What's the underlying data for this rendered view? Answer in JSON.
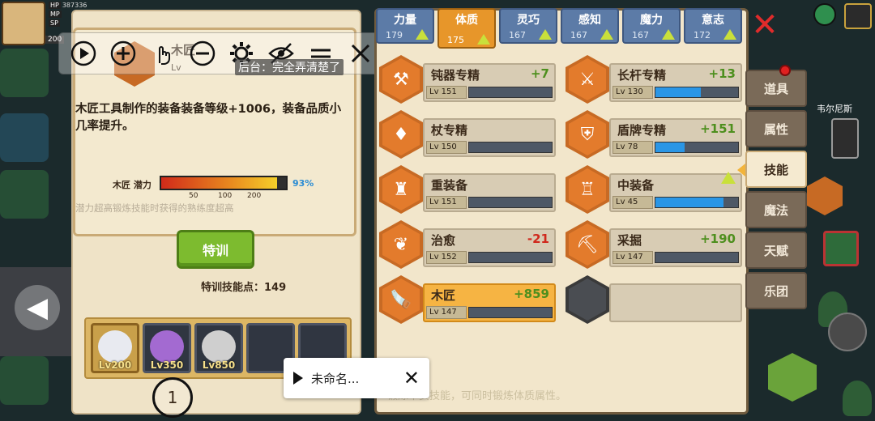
{
  "hud": {
    "hp_label": "HP",
    "hp_value": "387336",
    "mp_label": "MP",
    "sp_label": "SP",
    "level": "200"
  },
  "selected_skill": {
    "name": "木匠",
    "level": "Lv",
    "description": "木匠工具制作的装备装备等级+1006，装备品质小几率提升。",
    "potential_label": "木匠 潜力",
    "potential_percent": "93%",
    "potential_value": 0.93,
    "ticks": [
      "50",
      "100",
      "200"
    ],
    "note": "潜力超高锻炼技能时获得的熟练度超高"
  },
  "toolbar": {
    "caption": "后台：完全弄清楚了"
  },
  "training": {
    "button_label": "特训",
    "points_label": "特训技能点：",
    "points_value": "149"
  },
  "party": [
    {
      "level": "Lv200",
      "color": "#e8eaf0",
      "selected": true
    },
    {
      "level": "Lv350",
      "color": "#a36ad1",
      "selected": false
    },
    {
      "level": "Lv850",
      "color": "#cfcfcf",
      "selected": false
    },
    {
      "level": "",
      "color": "",
      "selected": false
    },
    {
      "level": "",
      "color": "",
      "selected": false
    }
  ],
  "crosshair_label": "1",
  "stat_tabs": [
    {
      "name": "力量",
      "value": "179",
      "active": false
    },
    {
      "name": "体质",
      "value": "175",
      "active": true
    },
    {
      "name": "灵巧",
      "value": "167",
      "active": false
    },
    {
      "name": "感知",
      "value": "167",
      "active": false
    },
    {
      "name": "魔力",
      "value": "167",
      "active": false
    },
    {
      "name": "意志",
      "value": "172",
      "active": false
    }
  ],
  "skills": [
    {
      "name": "钝器专精",
      "bonus": "+7",
      "bonus_color": "#4e8f1e",
      "lv": "Lv 151",
      "progress": 0,
      "icon": "hammer-icon",
      "glyph": "⚒"
    },
    {
      "name": "长杆专精",
      "bonus": "+13",
      "bonus_color": "#4e8f1e",
      "lv": "Lv 130",
      "progress": 0.55,
      "icon": "spear-icon",
      "glyph": "⚔"
    },
    {
      "name": "杖专精",
      "bonus": "",
      "bonus_color": "#4e8f1e",
      "lv": "Lv 150",
      "progress": 0,
      "icon": "staff-icon",
      "glyph": "♦"
    },
    {
      "name": "盾牌专精",
      "bonus": "+151",
      "bonus_color": "#4e8f1e",
      "lv": "Lv 78",
      "progress": 0.35,
      "icon": "shield-icon",
      "glyph": "⛨"
    },
    {
      "name": "重装备",
      "bonus": "",
      "bonus_color": "#4e8f1e",
      "lv": "Lv 151",
      "progress": 0,
      "icon": "heavy-armor-icon",
      "glyph": "♜"
    },
    {
      "name": "中装备",
      "bonus": "",
      "bonus_color": "#4e8f1e",
      "lv": "Lv 45",
      "progress": 0.82,
      "icon": "medium-armor-icon",
      "glyph": "♖",
      "up": true
    },
    {
      "name": "治愈",
      "bonus": "-21",
      "bonus_color": "#d0281c",
      "lv": "Lv 152",
      "progress": 0,
      "icon": "heal-icon",
      "glyph": "❦"
    },
    {
      "name": "采掘",
      "bonus": "+190",
      "bonus_color": "#4e8f1e",
      "lv": "Lv 147",
      "progress": 0,
      "icon": "pickaxe-icon",
      "glyph": "⛏"
    },
    {
      "name": "木匠",
      "bonus": "+859",
      "bonus_color": "#4e8f1e",
      "lv": "Lv 147",
      "progress": 0,
      "icon": "saw-icon",
      "glyph": "🪚",
      "highlight": true
    },
    {
      "name": "",
      "bonus": "",
      "bonus_color": "",
      "lv": "",
      "progress": 0,
      "icon": "empty-slot-icon",
      "glyph": "",
      "empty": true
    }
  ],
  "footer_hint": "锻炼本页技能，可同时锻炼体质属性。",
  "side_tabs": [
    {
      "label": "道具",
      "active": false,
      "dot": true
    },
    {
      "label": "属性",
      "active": false,
      "dot": false
    },
    {
      "label": "技能",
      "active": true,
      "dot": false
    },
    {
      "label": "魔法",
      "active": false,
      "dot": false
    },
    {
      "label": "天赋",
      "active": false,
      "dot": false
    },
    {
      "label": "乐团",
      "active": false,
      "dot": false
    }
  ],
  "npc_name": "韦尔尼斯",
  "recording": {
    "title": "未命名..."
  }
}
